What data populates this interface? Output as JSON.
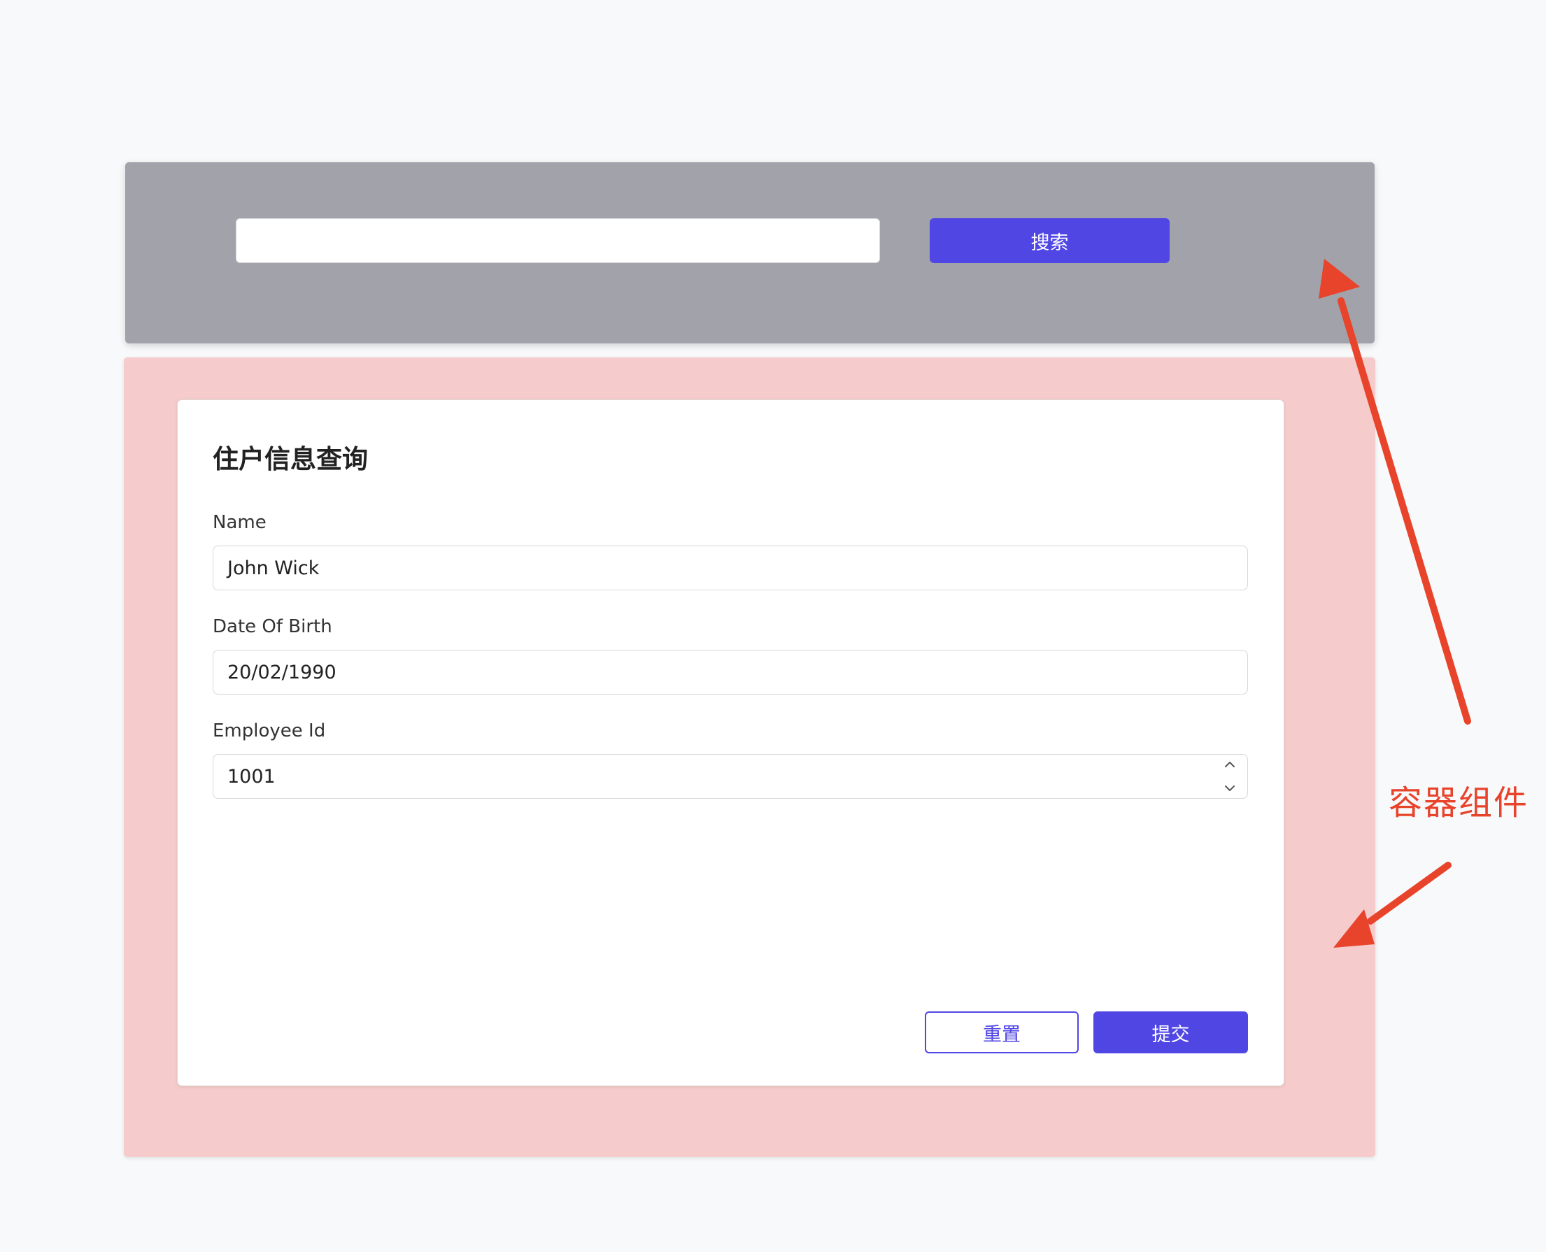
{
  "search": {
    "input_value": "",
    "button_label": "搜索"
  },
  "form": {
    "title": "住户信息查询",
    "fields": [
      {
        "label": "Name",
        "value": "John Wick"
      },
      {
        "label": "Date Of Birth",
        "value": "20/02/1990"
      },
      {
        "label": "Employee Id",
        "value": "1001"
      }
    ],
    "reset_label": "重置",
    "submit_label": "提交"
  },
  "annotation": {
    "label": "容器组件",
    "color": "#e8432b"
  },
  "colors": {
    "page_background": "#f8f9fa",
    "search_container": "#a1a2aa",
    "pink_container": "#f5cccb",
    "primary": "#5046e3"
  },
  "icons": {
    "stepper_up": "chevron-up-icon",
    "stepper_down": "chevron-down-icon"
  }
}
